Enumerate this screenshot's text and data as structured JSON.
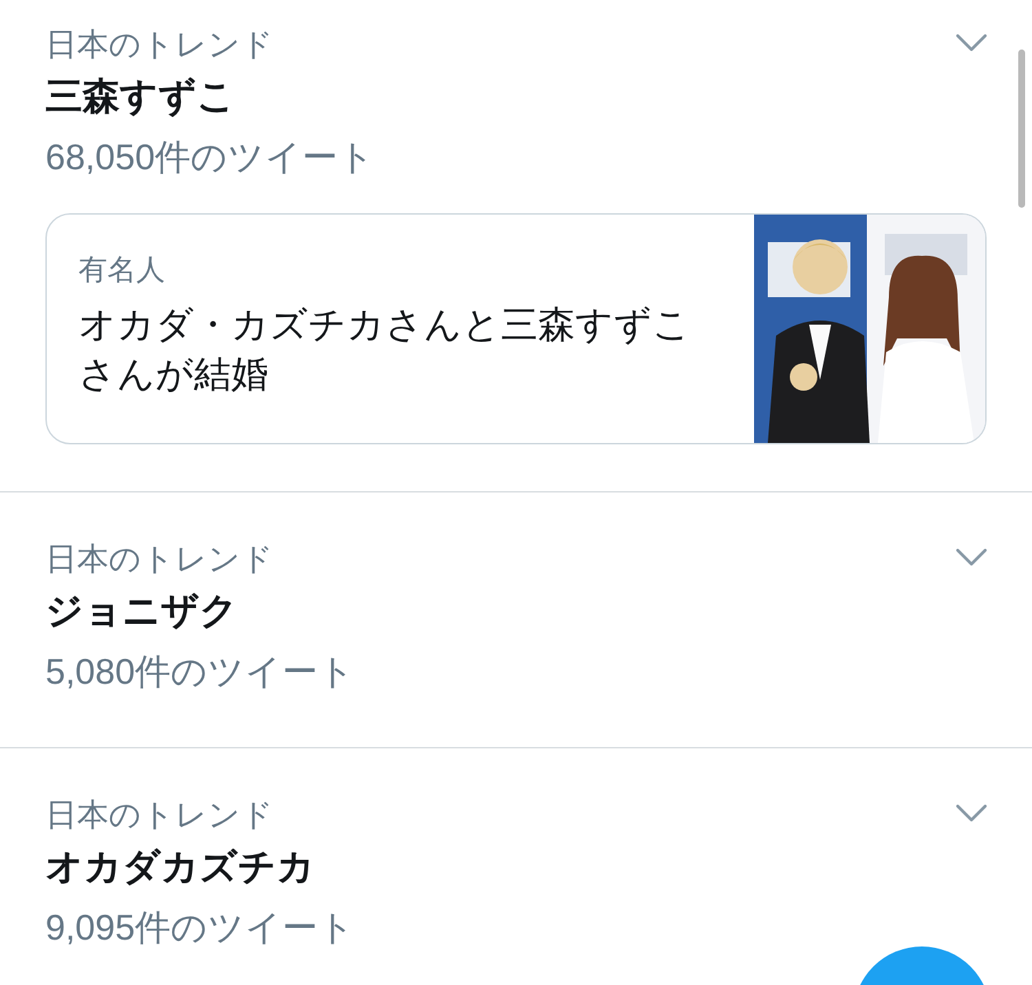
{
  "trends": [
    {
      "category": "日本のトレンド",
      "name": "三森すずこ",
      "count": "68,050件のツイート",
      "card": {
        "category": "有名人",
        "headline": "オカダ・カズチカさんと三森すずこさんが結婚"
      }
    },
    {
      "category": "日本のトレンド",
      "name": "ジョニザク",
      "count": "5,080件のツイート"
    },
    {
      "category": "日本のトレンド",
      "name": "オカダカズチカ",
      "count": "9,095件のツイート"
    }
  ]
}
